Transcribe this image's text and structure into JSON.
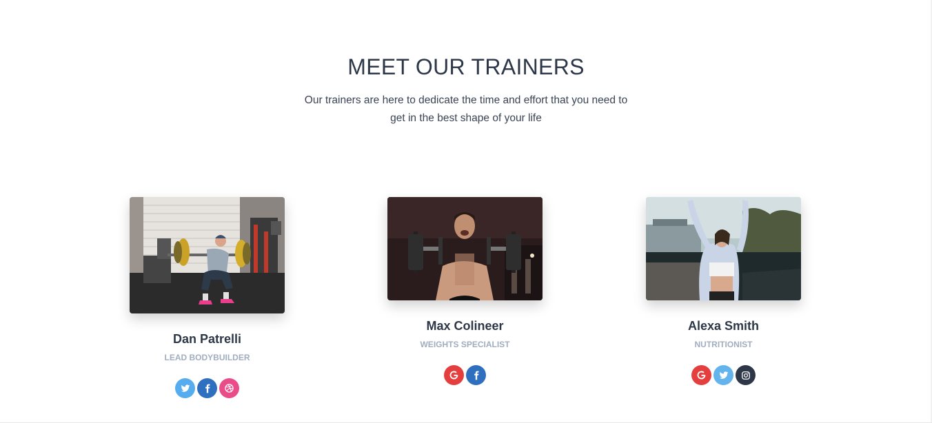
{
  "section": {
    "title": "MEET OUR TRAINERS",
    "subtitle_line1": "Our trainers are here to dedicate the time and effort that you need to",
    "subtitle_line2": "get in the best shape of your life"
  },
  "trainers": [
    {
      "name": "Dan Patrelli",
      "role": "LEAD BODYBUILDER",
      "socials": [
        "twitter",
        "facebook",
        "dribbble"
      ]
    },
    {
      "name": "Max Colineer",
      "role": "WEIGHTS SPECIALIST",
      "socials": [
        "google",
        "facebook"
      ]
    },
    {
      "name": "Alexa Smith",
      "role": "NUTRITIONIST",
      "socials": [
        "google",
        "twitter",
        "instagram"
      ]
    }
  ],
  "colors": {
    "heading": "#2d3748",
    "muted": "#a0aec0",
    "twitter": "#55acee",
    "facebook": "#3b5998",
    "dribbble": "#ea4c89",
    "google": "#dd4b39",
    "instagram": "#1f2937"
  }
}
